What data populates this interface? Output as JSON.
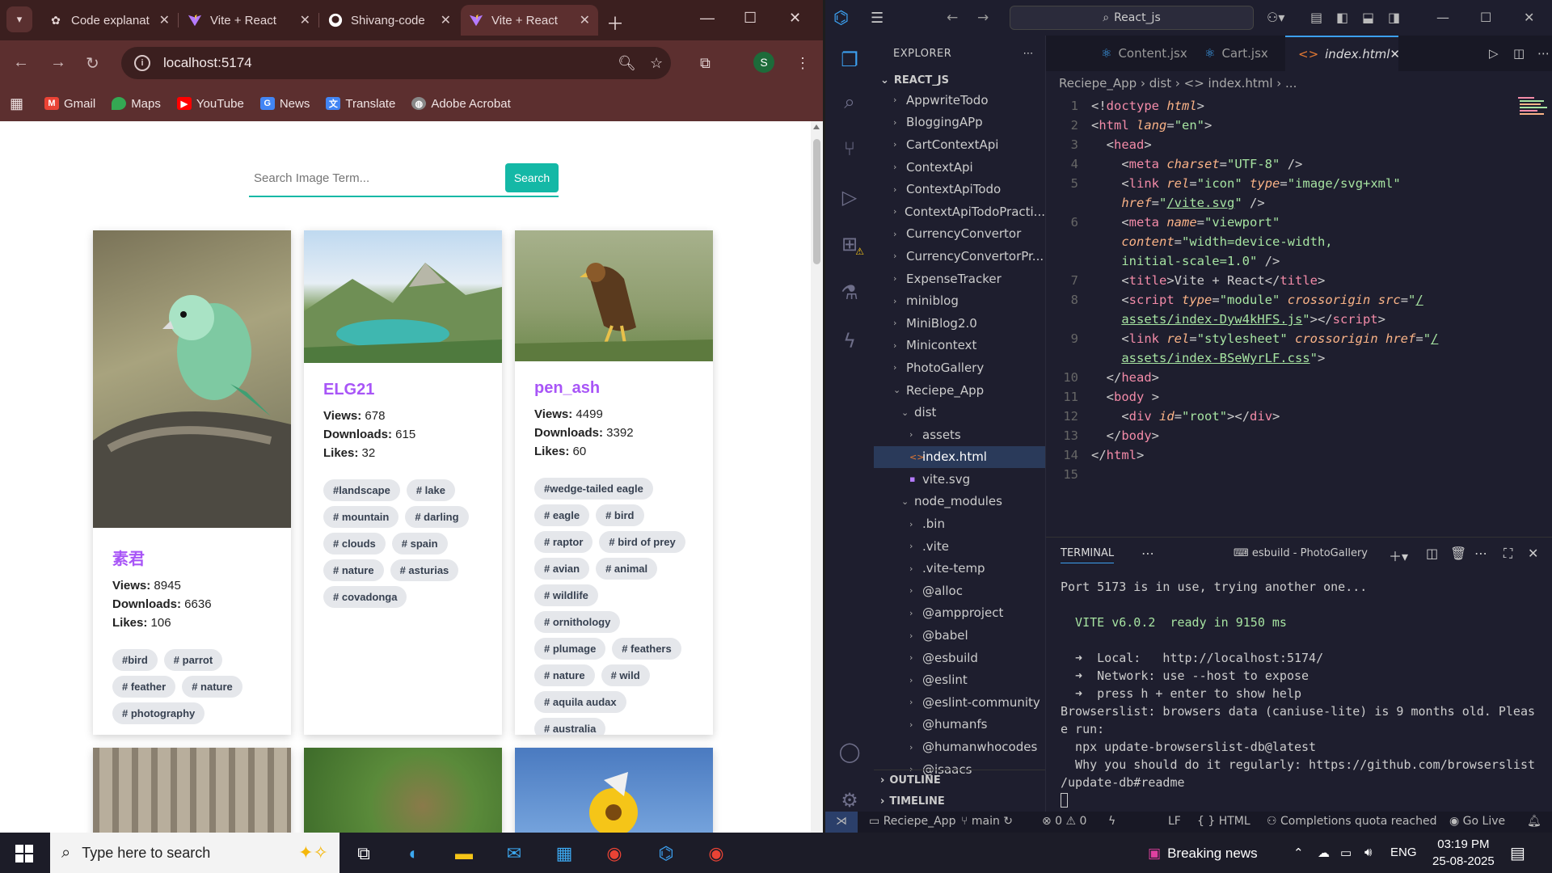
{
  "chrome": {
    "tabs": [
      {
        "title": "Code explanat",
        "icon": "openai-icon"
      },
      {
        "title": "Vite + React",
        "icon": "vite-icon"
      },
      {
        "title": "Shivang-code",
        "icon": "github-icon"
      },
      {
        "title": "Vite + React",
        "icon": "vite-icon"
      }
    ],
    "url": "localhost:5174",
    "profile_initial": "S",
    "bookmarks": [
      "Gmail",
      "Maps",
      "YouTube",
      "News",
      "Translate",
      "Adobe Acrobat"
    ]
  },
  "app": {
    "search_placeholder": "Search Image Term...",
    "search_button": "Search",
    "cards": [
      {
        "user": "素君",
        "views_label": "Views:",
        "views": "8945",
        "downloads_label": "Downloads:",
        "downloads": "6636",
        "likes_label": "Likes:",
        "likes": "106",
        "tags": [
          "#bird",
          "# parrot",
          "# feather",
          "# nature",
          "# photography"
        ]
      },
      {
        "user": "ELG21",
        "views_label": "Views:",
        "views": "678",
        "downloads_label": "Downloads:",
        "downloads": "615",
        "likes_label": "Likes:",
        "likes": "32",
        "tags": [
          "#landscape",
          "# lake",
          "# mountain",
          "# darling",
          "# clouds",
          "# spain",
          "# nature",
          "# asturias",
          "# covadonga"
        ]
      },
      {
        "user": "pen_ash",
        "views_label": "Views:",
        "views": "4499",
        "downloads_label": "Downloads:",
        "downloads": "3392",
        "likes_label": "Likes:",
        "likes": "60",
        "tags": [
          "#wedge-tailed eagle",
          "# eagle",
          "# bird",
          "# raptor",
          "# bird of prey",
          "# avian",
          "# animal",
          "# wildlife",
          "# ornithology",
          "# plumage",
          "# feathers",
          "# nature",
          "# wild",
          "# aquila audax",
          "# australia"
        ]
      }
    ]
  },
  "vscode": {
    "search": "React_js",
    "explorer_title": "EXPLORER",
    "root": "REACT_JS",
    "tree": [
      {
        "label": "AppwriteTodo",
        "depth": 0,
        "chev": "›"
      },
      {
        "label": "BloggingAPp",
        "depth": 0,
        "chev": "›"
      },
      {
        "label": "CartContextApi",
        "depth": 0,
        "chev": "›"
      },
      {
        "label": "ContextApi",
        "depth": 0,
        "chev": "›"
      },
      {
        "label": "ContextApiTodo",
        "depth": 0,
        "chev": "›"
      },
      {
        "label": "ContextApiTodoPracti...",
        "depth": 0,
        "chev": "›"
      },
      {
        "label": "CurrencyConvertor",
        "depth": 0,
        "chev": "›"
      },
      {
        "label": "CurrencyConvertorPr...",
        "depth": 0,
        "chev": "›"
      },
      {
        "label": "ExpenseTracker",
        "depth": 0,
        "chev": "›"
      },
      {
        "label": "miniblog",
        "depth": 0,
        "chev": "›"
      },
      {
        "label": "MiniBlog2.0",
        "depth": 0,
        "chev": "›"
      },
      {
        "label": "Minicontext",
        "depth": 0,
        "chev": "›"
      },
      {
        "label": "PhotoGallery",
        "depth": 0,
        "chev": "›"
      },
      {
        "label": "Reciepe_App",
        "depth": 0,
        "chev": "⌄"
      },
      {
        "label": "dist",
        "depth": 1,
        "chev": "⌄"
      },
      {
        "label": "assets",
        "depth": 2,
        "chev": "›"
      },
      {
        "label": "index.html",
        "depth": 2,
        "chev": "<>",
        "sel": true
      },
      {
        "label": "vite.svg",
        "depth": 2,
        "chev": "▪"
      },
      {
        "label": "node_modules",
        "depth": 1,
        "chev": "⌄"
      },
      {
        "label": ".bin",
        "depth": 2,
        "chev": "›"
      },
      {
        "label": ".vite",
        "depth": 2,
        "chev": "›"
      },
      {
        "label": ".vite-temp",
        "depth": 2,
        "chev": "›"
      },
      {
        "label": "@alloc",
        "depth": 2,
        "chev": "›"
      },
      {
        "label": "@ampproject",
        "depth": 2,
        "chev": "›"
      },
      {
        "label": "@babel",
        "depth": 2,
        "chev": "›"
      },
      {
        "label": "@esbuild",
        "depth": 2,
        "chev": "›"
      },
      {
        "label": "@eslint",
        "depth": 2,
        "chev": "›"
      },
      {
        "label": "@eslint-community",
        "depth": 2,
        "chev": "›"
      },
      {
        "label": "@humanfs",
        "depth": 2,
        "chev": "›"
      },
      {
        "label": "@humanwhocodes",
        "depth": 2,
        "chev": "›"
      },
      {
        "label": "@isaacs",
        "depth": 2,
        "chev": "›"
      }
    ],
    "outline": "OUTLINE",
    "timeline": "TIMELINE",
    "editor_tabs": [
      "Content.jsx",
      "Cart.jsx",
      "index.html"
    ],
    "breadcrumb": "Reciepe_App › dist › <> index.html › ...",
    "terminal_label": "TERMINAL",
    "terminal_name": "esbuild - PhotoGallery",
    "terminal_lines": [
      "Port 5173 is in use, trying another one...",
      "",
      "  VITE v6.0.2  ready in 9150 ms",
      "",
      "  ➜  Local:   http://localhost:5174/",
      "  ➜  Network: use --host to expose",
      "  ➜  press h + enter to show help",
      "Browserslist: browsers data (caniuse-lite) is 9 months old. Pleas",
      "e run:",
      "  npx update-browserslist-db@latest",
      "  Why you should do it regularly: https://github.com/browserslist",
      "/update-db#readme"
    ],
    "status": {
      "branch_repo": "Reciepe_App",
      "branch": "main",
      "problems": "⊗ 0 ⚠ 0",
      "eol": "LF",
      "lang": "{ } HTML",
      "copilot": "Completions quota reached",
      "golive": "Go Live"
    }
  },
  "taskbar": {
    "search_placeholder": "Type here to search",
    "news": "Breaking news",
    "lang": "ENG",
    "time": "03:19 PM",
    "date": "25-08-2025"
  }
}
